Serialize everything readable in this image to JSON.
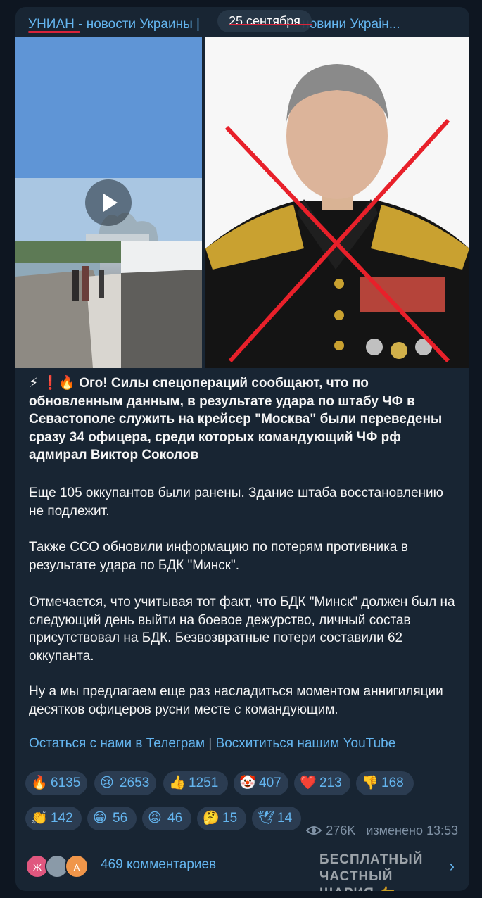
{
  "channel": {
    "name": "УНИАН",
    "rest": " - новости Украины | ",
    "rest_tail": "новини Украін...",
    "date_pill": "25 сентября"
  },
  "post": {
    "emoji_prefix": "⚡ ❗🔥",
    "headline": "Ого! Силы спецопераций сообщают, что по обновленным данным, в результате удара по штабу ЧФ в Севастополе служить на крейсер \"Москва\" были переведены сразу 34 офицера, среди которых командующий ЧФ рф адмирал Виктор Соколов",
    "p1": "Еще 105 оккупантов были ранены. Здание штаба восстановлению не подлежит.",
    "p2": "Также ССО обновили информацию по потерям противника в результате удара по БДК \"Минск\".",
    "p3": "Отмечается, что учитывая тот факт, что БДК \"Минск\" должен был на следующий день выйти на боевое дежурство, личный состав присутствовал на БДК. Безвозвратные потери составили 62 оккупанта.",
    "p4": "Ну а мы предлагаем еще раз насладиться моментом аннигиляции десятков офицеров русни месте с командующим.",
    "link1": "Остаться с нами в Телеграм",
    "separator": "|",
    "link2": "Восхититься нашим YouTube"
  },
  "reactions": [
    {
      "emoji": "🔥",
      "icon": "fire-icon",
      "count": "6135"
    },
    {
      "emoji": "😢",
      "icon": "crying-face-icon",
      "count": "2653"
    },
    {
      "emoji": "👍",
      "icon": "thumbs-up-icon",
      "count": "1251"
    },
    {
      "emoji": "🤡",
      "icon": "clown-icon",
      "count": "407"
    },
    {
      "emoji": "❤️",
      "icon": "heart-icon",
      "count": "213"
    },
    {
      "emoji": "👎",
      "icon": "thumbs-down-icon",
      "count": "168"
    },
    {
      "emoji": "👏",
      "icon": "clapping-icon",
      "count": "142"
    },
    {
      "emoji": "😁",
      "icon": "grin-icon",
      "count": "56"
    },
    {
      "emoji": "😡",
      "icon": "angry-face-icon",
      "count": "46"
    },
    {
      "emoji": "🤔",
      "icon": "thinking-face-icon",
      "count": "15"
    },
    {
      "emoji": "🕊",
      "icon": "dove-icon",
      "count": "14"
    }
  ],
  "meta": {
    "views": "276K",
    "edited": "изменено 13:53"
  },
  "comments": {
    "avatar1": "Ж",
    "avatar3": "А",
    "label": "469 комментариев"
  },
  "watermark": {
    "line1": "БЕСПЛАТНЫЙ ЧАСТНЫЙ",
    "line2": "ШАРИЯ 👉 Sharij.net"
  },
  "colors": {
    "background": "#0e1621",
    "bubble": "#182533",
    "accent": "#64b5ef",
    "reaction_bg": "#2b3c51",
    "underline_red": "#d9243a"
  }
}
